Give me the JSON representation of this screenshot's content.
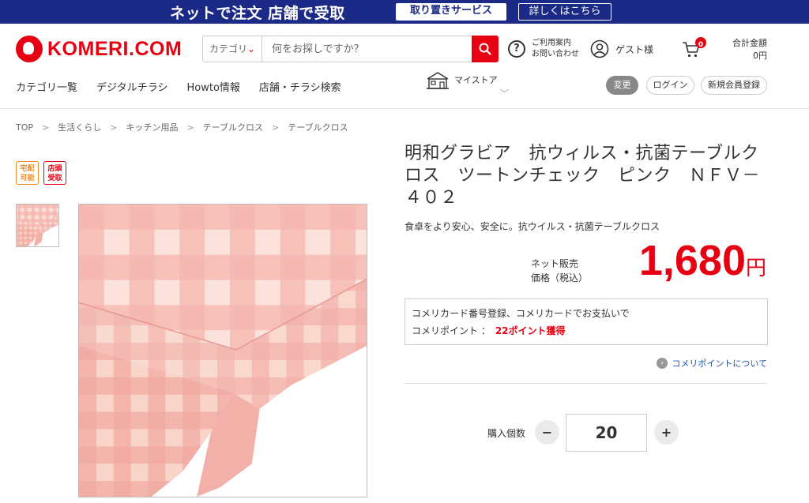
{
  "promo": {
    "main": "ネットで注文 店舗で受取",
    "service": "取り置きサービス",
    "details": "詳しくはこちら"
  },
  "header": {
    "logo_text": "KOMERI.COM",
    "search": {
      "category": "カテゴリ",
      "placeholder": "何をお探しですか？"
    },
    "help": {
      "line1": "ご利用案内",
      "line2": "お問い合わせ"
    },
    "guest": "ゲスト様",
    "cart_count": "0",
    "total_label": "合計金額",
    "total_value": "0円"
  },
  "nav": {
    "items": [
      "カテゴリ一覧",
      "デジタルチラシ",
      "Howto情報",
      "店舗・チラシ検索"
    ],
    "mystore": "マイストア",
    "change": "変更",
    "login": "ログイン",
    "register": "新規会員登録"
  },
  "breadcrumb": [
    "TOP",
    "生活くらし",
    "キッチン用品",
    "テーブルクロス",
    "テーブルクロス"
  ],
  "badges": {
    "delivery_line1": "宅配",
    "delivery_line2": "可能",
    "store_line1": "店頭",
    "store_line2": "受取"
  },
  "product": {
    "title": "明和グラビア　抗ウィルス・抗菌テーブルクロス　ツートンチェック　ピンク　ＮＦＶ－４０２",
    "subtitle": "食卓をより安心、安全に。抗ウイルス・抗菌テーブルクロス",
    "price_label_line1": "ネット販売",
    "price_label_line2": "価格（税込）",
    "price": "1,680",
    "price_unit": "円",
    "points_line1": "コメリカード番号登録、コメリカードでお支払いで",
    "points_label": "コメリポイント ：",
    "points_value": "22ポイント獲得",
    "points_link": "コメリポイントについて",
    "qty_label": "購入個数",
    "qty_value": "20",
    "minus": "−",
    "plus": "+"
  },
  "colors": {
    "brand_red": "#e60012",
    "banner_navy": "#1c2a87",
    "cloth_pink": "#f0a9a8"
  }
}
